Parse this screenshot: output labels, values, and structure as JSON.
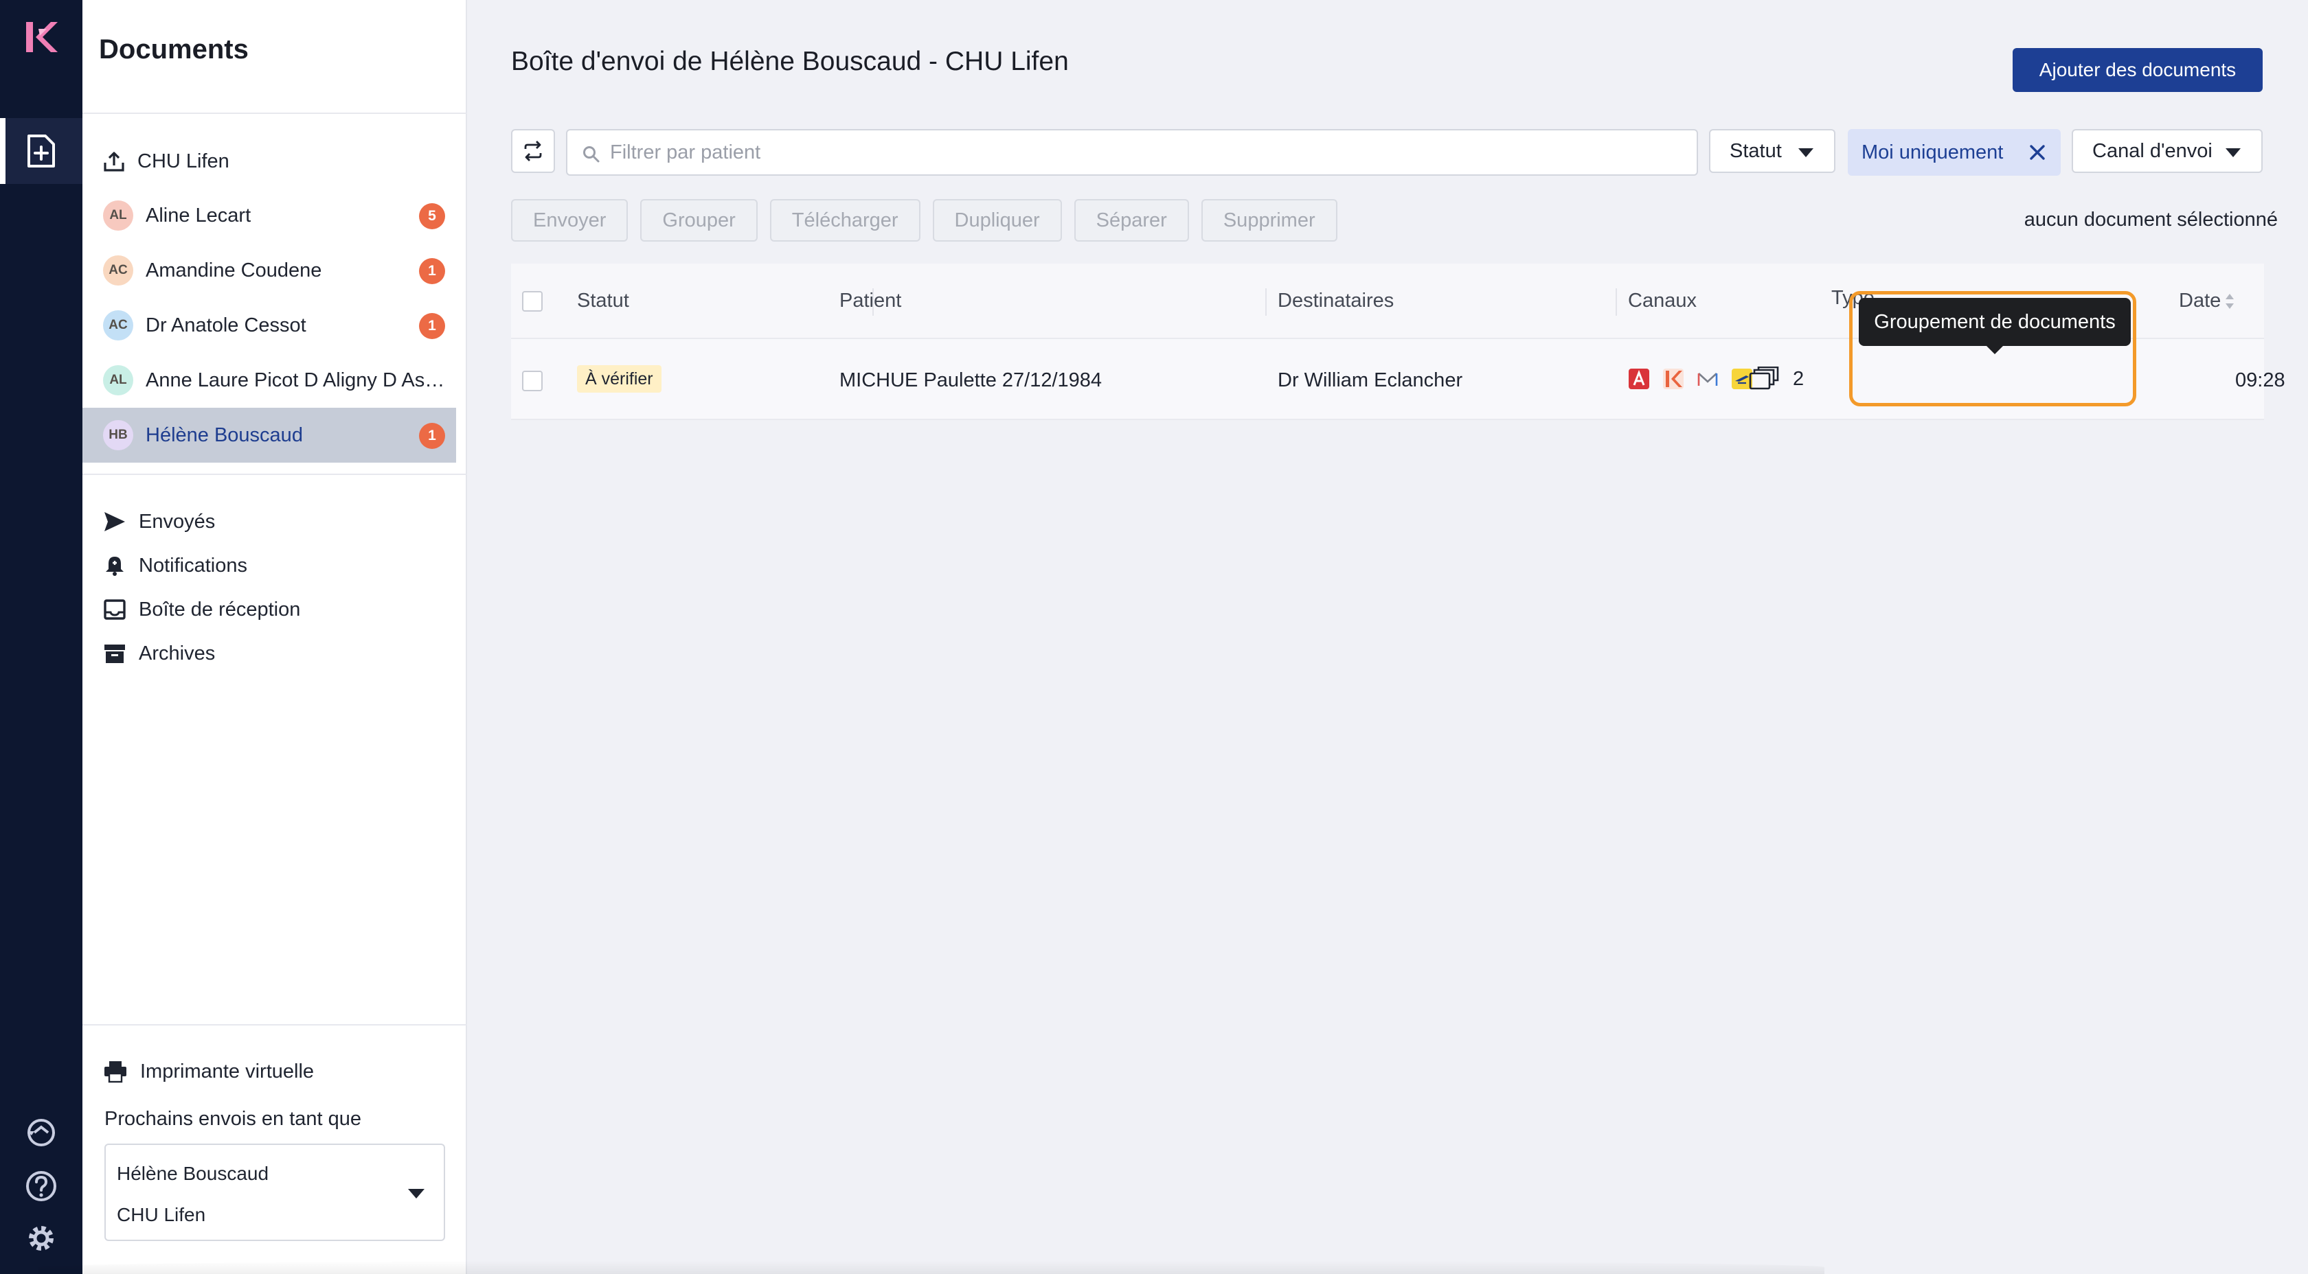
{
  "sidebar": {
    "title": "Documents",
    "group": "CHU Lifen",
    "people": [
      {
        "initials": "AL",
        "name": "Aline Lecart",
        "count": "5",
        "color": "#f7c9bf"
      },
      {
        "initials": "AC",
        "name": "Amandine Coudene",
        "count": "1",
        "color": "#f9d8c0"
      },
      {
        "initials": "AC",
        "name": "Dr Anatole Cessot",
        "count": "1",
        "color": "#c3e0f6"
      },
      {
        "initials": "AL",
        "name": "Anne Laure Picot D Aligny D Ass...",
        "count": "",
        "color": "#c9efe6"
      },
      {
        "initials": "HB",
        "name": "Hélène Bouscaud",
        "count": "1",
        "color": "#e3d9f5"
      }
    ],
    "nav": [
      {
        "label": "Envoyés",
        "icon": "send-icon"
      },
      {
        "label": "Notifications",
        "icon": "bell-icon"
      },
      {
        "label": "Boîte de réception",
        "icon": "inbox-icon"
      },
      {
        "label": "Archives",
        "icon": "archive-icon"
      }
    ],
    "printer_label": "Imprimante virtuelle",
    "send_as_label": "Prochains envois en tant que",
    "send_as_name": "Hélène Bouscaud",
    "send_as_org": "CHU Lifen"
  },
  "main": {
    "title": "Boîte d'envoi de Hélène Bouscaud - CHU Lifen",
    "add_button": "Ajouter des documents",
    "search_placeholder": "Filtrer par patient",
    "status_filter": "Statut",
    "me_only_chip": "Moi uniquement",
    "channel_filter": "Canal d'envoi",
    "actions": [
      "Envoyer",
      "Grouper",
      "Télécharger",
      "Dupliquer",
      "Séparer",
      "Supprimer"
    ],
    "selection_note": "aucun document sélectionné",
    "columns": {
      "status": "Statut",
      "patient": "Patient",
      "recipients": "Destinataires",
      "channels": "Canaux",
      "type": "Type",
      "date": "Date"
    },
    "rows": [
      {
        "status": "À vérifier",
        "patient": "MICHUE Paulette  27/12/1984",
        "recipients": "Dr William Eclancher",
        "type_count": "2",
        "date": "09:28"
      }
    ],
    "tooltip": "Groupement de documents"
  },
  "colors": {
    "rail": "#0d1730",
    "primary": "#1d3f94",
    "badge": "#ec6a45",
    "highlight": "#f39a2a",
    "status_badge": "#fff0c6"
  }
}
